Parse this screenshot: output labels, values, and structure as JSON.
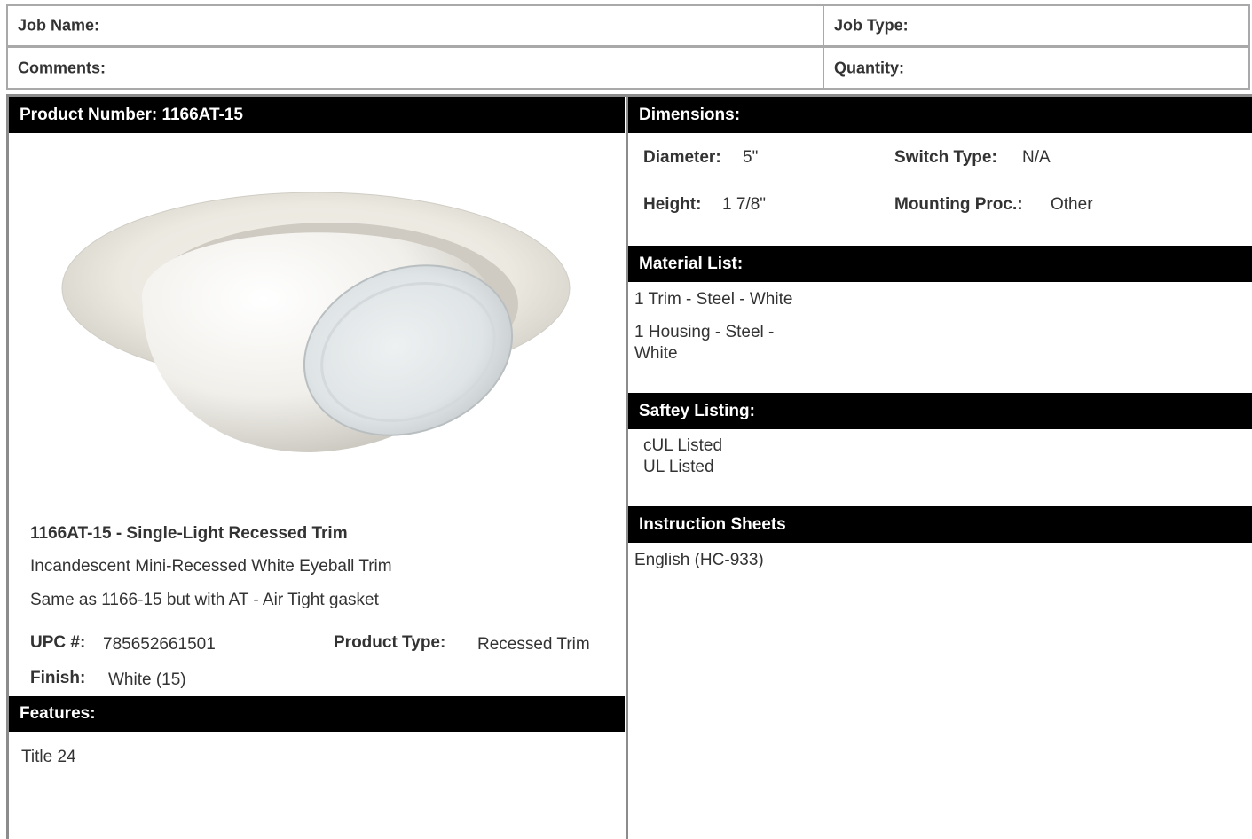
{
  "header": {
    "job_name_label": "Job Name:",
    "job_type_label": "Job Type:",
    "comments_label": "Comments:",
    "quantity_label": "Quantity:"
  },
  "product": {
    "number_header": "Product Number: 1166AT-15",
    "title": "1166AT-15 - Single-Light Recessed Trim",
    "description_1": "Incandescent Mini-Recessed White Eyeball Trim",
    "description_2": "Same as 1166-15 but with AT - Air Tight gasket",
    "upc_label": "UPC #:",
    "upc_value": "785652661501",
    "product_type_label": "Product Type:",
    "product_type_value": "Recessed Trim",
    "finish_label": "Finish:",
    "finish_value": "White (15)"
  },
  "features": {
    "header": "Features:",
    "items": [
      "Title 24"
    ]
  },
  "dimensions": {
    "header": "Dimensions:",
    "diameter_label": "Diameter:",
    "diameter_value": "5\"",
    "height_label": "Height:",
    "height_value": "1 7/8\"",
    "switch_type_label": "Switch Type:",
    "switch_type_value": "N/A",
    "mounting_label": "Mounting Proc.:",
    "mounting_value": "Other"
  },
  "material_list": {
    "header": "Material List:",
    "item_1": "1 Trim - Steel - White",
    "item_2_line1": "1 Housing - Steel -",
    "item_2_line2": "White"
  },
  "safety_listing": {
    "header": "Saftey Listing:",
    "item_1": "cUL Listed",
    "item_2": "UL Listed"
  },
  "instruction_sheets": {
    "header": "Instruction Sheets",
    "link_1": "English (HC-933)"
  }
}
